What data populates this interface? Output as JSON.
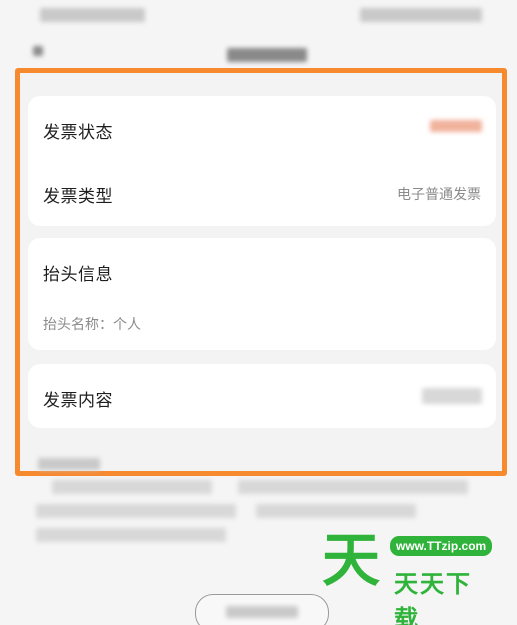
{
  "invoice": {
    "status_label": "发票状态",
    "type_label": "发票类型",
    "type_value": "电子普通发票",
    "header_section_title": "抬头信息",
    "header_name_line": "抬头名称：个人",
    "content_label": "发票内容"
  },
  "watermark": {
    "big_char": "天",
    "url": "www.TTzip.com",
    "text": "天天下载"
  },
  "colors": {
    "highlight": "#f7892f",
    "watermark_green": "#2fb33a"
  }
}
